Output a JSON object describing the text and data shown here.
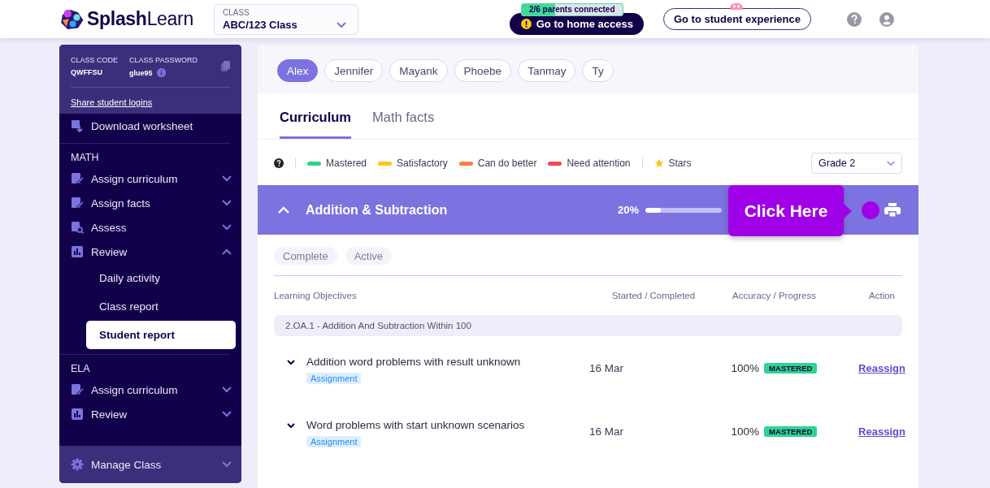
{
  "header": {
    "logo": "**Splash**Learn",
    "class_select": {
      "label": "CLASS",
      "value": "ABC/123 Class"
    },
    "parents_badge": {
      "text": "2/6 parents connected",
      "level": 0.33
    },
    "home_access_button": "Go to home access",
    "student_experience_button": "Go to student experience"
  },
  "sidebar": {
    "class_code": {
      "label": "CLASS CODE",
      "value": "QWFFSU"
    },
    "class_password": {
      "label": "CLASS PASSWORD",
      "value": "glue95"
    },
    "share_link": "Share student logins",
    "top_items": [
      {
        "label": "Download worksheet",
        "kind": "download"
      }
    ],
    "sections": [
      {
        "title": "MATH",
        "items": [
          {
            "label": "Assign curriculum",
            "kind": "assign",
            "expanded": false
          },
          {
            "label": "Assign facts",
            "kind": "assign",
            "expanded": false
          },
          {
            "label": "Assess",
            "kind": "assess",
            "expanded": false
          },
          {
            "label": "Review",
            "kind": "review",
            "expanded": true,
            "children": [
              {
                "label": "Daily activity",
                "selected": false
              },
              {
                "label": "Class report",
                "selected": false
              },
              {
                "label": "Student report",
                "selected": true
              }
            ]
          }
        ]
      },
      {
        "title": "ELA",
        "items": [
          {
            "label": "Assign curriculum",
            "kind": "assign",
            "expanded": false
          },
          {
            "label": "Review",
            "kind": "review",
            "expanded": false
          }
        ]
      }
    ],
    "footer": {
      "label": "Manage Class",
      "expanded": false
    }
  },
  "students": [
    {
      "name": "Alex",
      "selected": true
    },
    {
      "name": "Jennifer",
      "selected": false
    },
    {
      "name": "Mayank",
      "selected": false
    },
    {
      "name": "Phoebe",
      "selected": false
    },
    {
      "name": "Tanmay",
      "selected": false
    },
    {
      "name": "Ty",
      "selected": false
    }
  ],
  "tabs": [
    {
      "label": "Curriculum",
      "selected": true
    },
    {
      "label": "Math facts",
      "selected": false
    }
  ],
  "legend": [
    {
      "label": "Mastered",
      "color": "#2ed48f",
      "kind": "bar"
    },
    {
      "label": "Satisfactory",
      "color": "#fcc419",
      "kind": "bar"
    },
    {
      "label": "Can do better",
      "color": "#ff7a45",
      "kind": "bar"
    },
    {
      "label": "Need attention",
      "color": "#f5474f",
      "kind": "bar"
    },
    {
      "label": "Stars",
      "color": "#fcc419",
      "kind": "star"
    }
  ],
  "grade_select": "Grade 2",
  "unit": {
    "title": "Addition & Subtraction",
    "expanded": true,
    "progress_text": "20%",
    "level": 0.2
  },
  "tooltip": "Click Here",
  "filters": [
    "Complete",
    "Active"
  ],
  "table": {
    "columns": [
      "Learning Objectives",
      "Started / Completed",
      "Accuracy / Progress",
      "Action"
    ],
    "group": "2.OA.1 - Addition And Subtraction Within 100",
    "rows": [
      {
        "title": "Addition word problems with result unknown",
        "tag": "Assignment",
        "date": "16 Mar",
        "accuracy": "100%",
        "status": "MASTERED",
        "action": "Reassign",
        "expanded": false
      },
      {
        "title": "Word problems with start unknown scenarios",
        "tag": "Assignment",
        "date": "16 Mar",
        "accuracy": "100%",
        "status": "MASTERED",
        "action": "Reassign",
        "expanded": false
      }
    ]
  }
}
